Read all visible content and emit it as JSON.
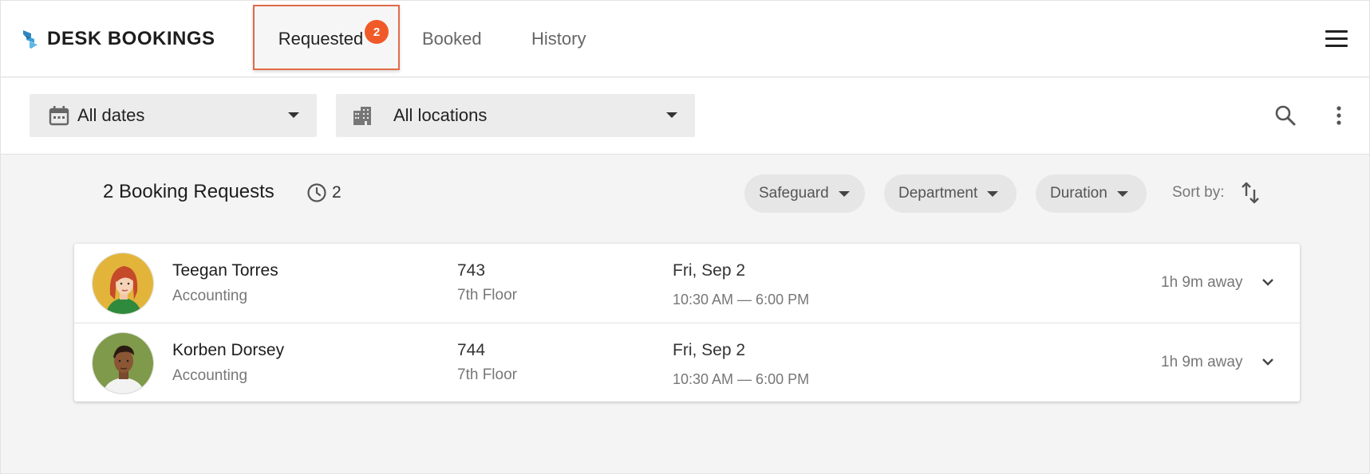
{
  "app": {
    "brand": "DESK BOOKINGS",
    "colors": {
      "accent": "#f05a28",
      "logo": "#3b9fd6"
    }
  },
  "tabs": [
    {
      "label": "Requested",
      "badge": "2",
      "active": true
    },
    {
      "label": "Booked"
    },
    {
      "label": "History"
    }
  ],
  "filters": {
    "dates": {
      "value": "All dates",
      "icon": "calendar-icon"
    },
    "locations": {
      "value": "All locations",
      "icon": "building-icon"
    }
  },
  "summary": {
    "title": "2 Booking Requests",
    "pending_count": "2"
  },
  "chips": [
    {
      "label": "Safeguard"
    },
    {
      "label": "Department"
    },
    {
      "label": "Duration"
    }
  ],
  "sort": {
    "label": "Sort by:"
  },
  "requests": [
    {
      "name": "Teegan Torres",
      "department": "Accounting",
      "desk": "743",
      "floor": "7th Floor",
      "date": "Fri, Sep 2",
      "time": "10:30 AM — 6:00 PM",
      "away": "1h 9m away"
    },
    {
      "name": "Korben Dorsey",
      "department": "Accounting",
      "desk": "744",
      "floor": "7th Floor",
      "date": "Fri, Sep 2",
      "time": "10:30 AM — 6:00 PM",
      "away": "1h 9m away"
    }
  ]
}
